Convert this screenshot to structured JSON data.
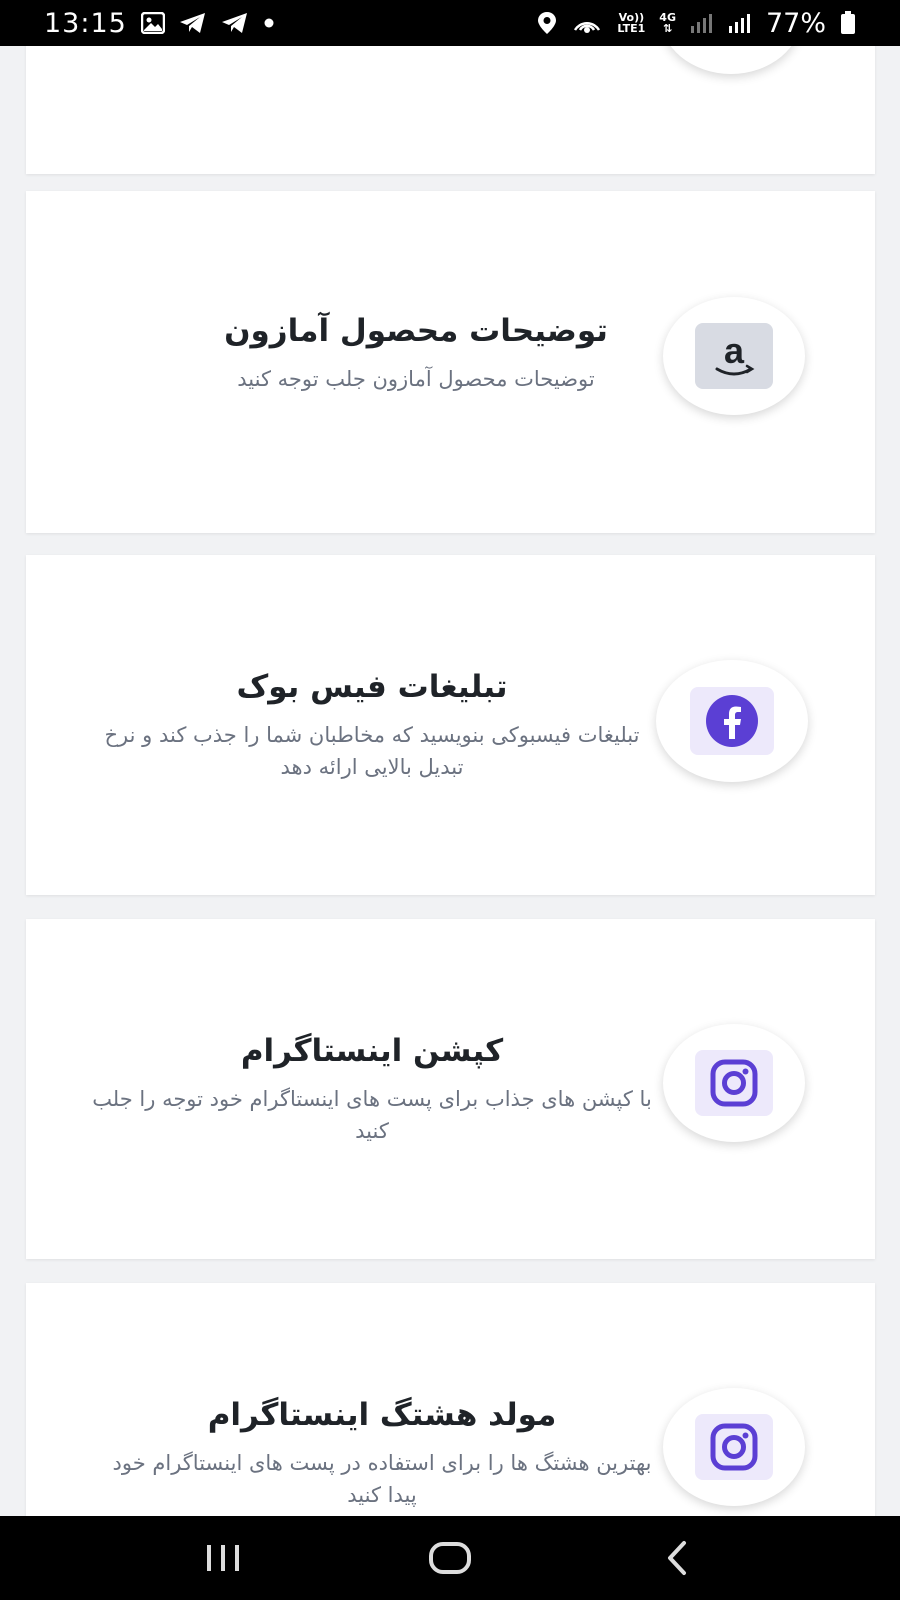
{
  "status_bar": {
    "time": "13:15",
    "battery": "77%",
    "network_top": "Vo))",
    "network_bottom": "LTE1",
    "network_type": "4G",
    "left_icons": [
      "gallery-icon",
      "telegram-icon",
      "telegram-icon",
      "dot-icon"
    ],
    "right_icons": [
      "location-icon",
      "hotspot-icon",
      "signal-icon",
      "signal-icon",
      "battery-icon"
    ]
  },
  "cards": [
    {
      "title": "",
      "description": "",
      "icon": "partial-icon"
    },
    {
      "title": "توضیحات محصول آمازون",
      "description": "توضیحات محصول آمازون جلب توجه کنید",
      "icon": "amazon-icon",
      "icon_bg": "#d8dbe3"
    },
    {
      "title": "تبلیغات فیس بوک",
      "description": "تبلیغات فیسبوکی بنویسید که مخاطبان شما را جذب کند و نرخ تبدیل بالایی ارائه دهد",
      "icon": "facebook-icon",
      "icon_bg": "#ede9fb"
    },
    {
      "title": "کپشن اینستاگرام",
      "description": "با کپشن های جذاب برای پست های اینستاگرام خود توجه را جلب کنید",
      "icon": "instagram-icon",
      "icon_bg": "#ede9fb"
    },
    {
      "title": "مولد هشتگ اینستاگرام",
      "description": "بهترین هشتگ ها را برای استفاده در پست های اینستاگرام خود پیدا کنید",
      "icon": "instagram-icon",
      "icon_bg": "#ede9fb"
    }
  ],
  "colors": {
    "accent": "#5b3fd4",
    "title": "#1f2328",
    "description": "#6b7280"
  },
  "nav": {
    "recents": "recents-icon",
    "home": "home-icon",
    "back": "back-icon"
  }
}
